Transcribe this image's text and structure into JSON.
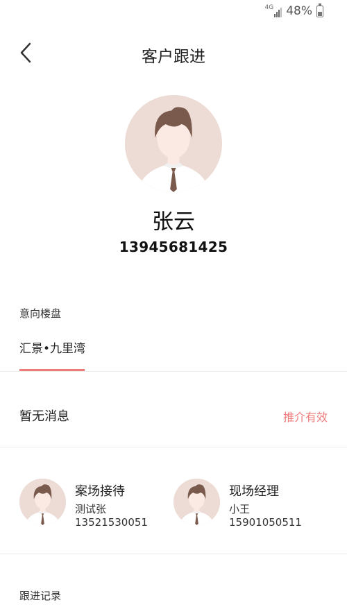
{
  "status_bar": {
    "network": "4G",
    "battery": "48%"
  },
  "header": {
    "title": "客户跟进",
    "back_icon": "chevron-left-icon"
  },
  "customer": {
    "name": "张云",
    "phone": "13945681425",
    "avatar_icon": "user-avatar-icon"
  },
  "intent_project": {
    "label": "意向楼盘",
    "project": "汇景•九里湾",
    "accent": "#ef7b7b"
  },
  "message": {
    "text": "暂无消息",
    "status": "推介有效",
    "status_color": "#ef7b7b"
  },
  "staff": [
    {
      "role": "案场接待",
      "name": "测试张",
      "phone": "13521530051"
    },
    {
      "role": "现场经理",
      "name": "小王",
      "phone": "15901050511"
    }
  ],
  "records": {
    "label": "跟进记录"
  }
}
